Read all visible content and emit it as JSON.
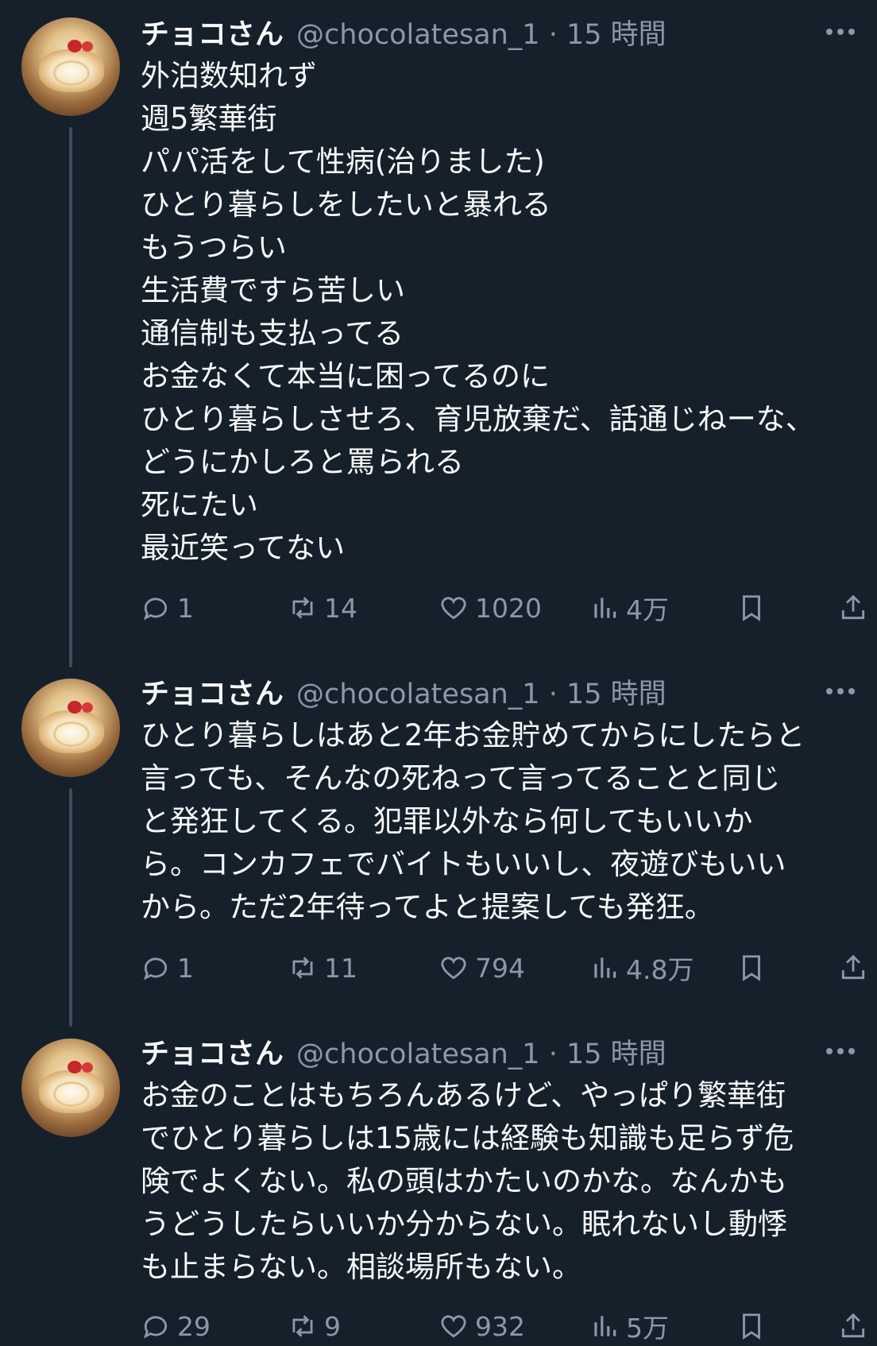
{
  "tweets": [
    {
      "author_name": "チョコさん",
      "handle_time": "@chocolatesan_1 · 15 時間",
      "lines": [
        "外泊数知れず",
        "週5繁華街",
        "パパ活をして性病(治りました)",
        "ひとり暮らしをしたいと暴れる",
        "もうつらい",
        "生活費ですら苦しい",
        "通信制も支払ってる",
        "お金なくて本当に困ってるのに",
        "ひとり暮らしさせろ、育児放棄だ、話通じねーな、",
        "どうにかしろと罵られる",
        "死にたい",
        "最近笑ってない"
      ],
      "replies": "1",
      "retweets": "14",
      "likes": "1020",
      "views": "4万"
    },
    {
      "author_name": "チョコさん",
      "handle_time": "@chocolatesan_1 · 15 時間",
      "lines": [
        "ひとり暮らしはあと2年お金貯めてからにしたらと",
        "言っても、そんなの死ねって言ってることと同じ",
        "と発狂してくる。犯罪以外なら何してもいいか",
        "ら。コンカフェでバイトもいいし、夜遊びもいい",
        "から。ただ2年待ってよと提案しても発狂。"
      ],
      "replies": "1",
      "retweets": "11",
      "likes": "794",
      "views": "4.8万"
    },
    {
      "author_name": "チョコさん",
      "handle_time": "@chocolatesan_1 · 15 時間",
      "lines": [
        "お金のことはもちろんあるけど、やっぱり繁華街",
        "でひとり暮らしは15歳には経験も知識も足らず危",
        "険でよくない。私の頭はかたいのかな。なんかも",
        "うどうしたらいいか分からない。眠れないし動悸",
        "も止まらない。相談場所もない。"
      ],
      "replies": "29",
      "retweets": "9",
      "likes": "932",
      "views": "5万"
    }
  ],
  "icons": {
    "reply": "reply-icon",
    "retweet": "retweet-icon",
    "like": "heart-icon",
    "views": "views-icon",
    "bookmark": "bookmark-icon",
    "share": "share-icon",
    "more": "more-icon",
    "avatar": "avatar-cake-image"
  },
  "colors": {
    "background": "#15202b",
    "text": "#f7f9f9",
    "secondary": "#8b98a5",
    "thread_line": "#3e4b57"
  }
}
